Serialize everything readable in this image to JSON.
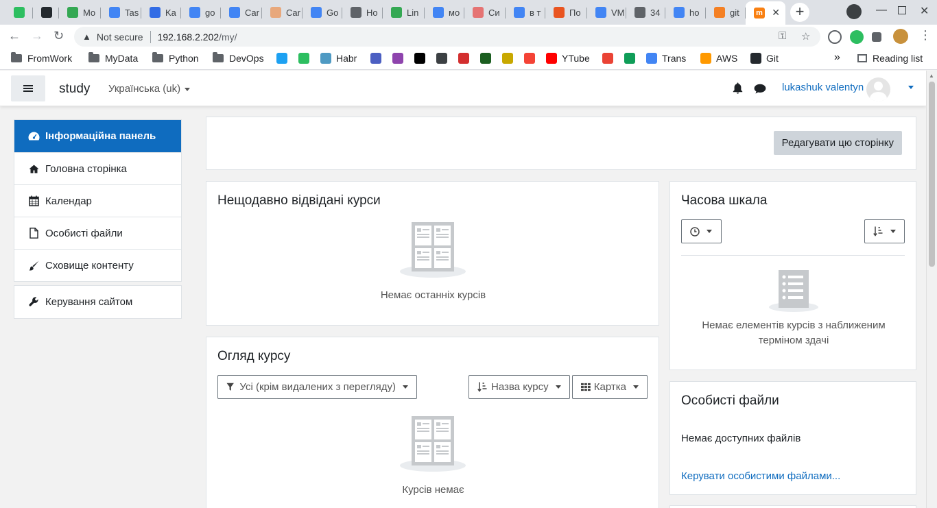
{
  "browser": {
    "tabs": [
      {
        "label": "",
        "color": "#2dbe60"
      },
      {
        "label": "",
        "color": "#24292e"
      },
      {
        "label": "Mo",
        "color": "#34a853"
      },
      {
        "label": "Tas",
        "color": "#4285f4"
      },
      {
        "label": "Ka",
        "color": "#326ce5"
      },
      {
        "label": "go",
        "color": "#4285f4"
      },
      {
        "label": "Car",
        "color": "#4285f4"
      },
      {
        "label": "Car",
        "color": "#e8a87c"
      },
      {
        "label": "Go",
        "color": "#4285f4"
      },
      {
        "label": "Ho",
        "color": "#5f6368"
      },
      {
        "label": "Lin",
        "color": "#34a853"
      },
      {
        "label": "мо",
        "color": "#4285f4"
      },
      {
        "label": "Си",
        "color": "#e57373"
      },
      {
        "label": "в т",
        "color": "#4285f4"
      },
      {
        "label": "По",
        "color": "#e95420"
      },
      {
        "label": "VM",
        "color": "#4285f4"
      },
      {
        "label": "34",
        "color": "#5f6368"
      },
      {
        "label": "ho",
        "color": "#4285f4"
      },
      {
        "label": "git",
        "color": "#f48024"
      }
    ],
    "active_tab_icon": "moodle-icon",
    "active_tab_close": "✕",
    "new_tab": "+",
    "address": {
      "warning": "Not secure",
      "host": "192.168.2.202",
      "path": "/my/"
    },
    "bookmarks": [
      {
        "label": "FromWork",
        "type": "folder"
      },
      {
        "label": "MyData",
        "type": "folder"
      },
      {
        "label": "Python",
        "type": "folder"
      },
      {
        "label": "DevOps",
        "type": "folder"
      },
      {
        "label": "",
        "type": "icon",
        "color": "#1da1f2"
      },
      {
        "label": "",
        "type": "icon",
        "color": "#2dbe60"
      },
      {
        "label": "Habr",
        "type": "icon",
        "color": "#4f9ac3"
      },
      {
        "label": "",
        "type": "icon",
        "color": "#4c5fc2"
      },
      {
        "label": "",
        "type": "icon",
        "color": "#8e44ad"
      },
      {
        "label": "",
        "type": "icon",
        "color": "#000000"
      },
      {
        "label": "",
        "type": "icon",
        "color": "#3c4043"
      },
      {
        "label": "",
        "type": "icon",
        "color": "#d32f2f"
      },
      {
        "label": "",
        "type": "icon",
        "color": "#1b5e20"
      },
      {
        "label": "",
        "type": "icon",
        "color": "#c8a800"
      },
      {
        "label": "",
        "type": "icon",
        "color": "#f44336"
      },
      {
        "label": "YTube",
        "type": "icon",
        "color": "#ff0000"
      },
      {
        "label": "",
        "type": "icon",
        "color": "#ea4335"
      },
      {
        "label": "",
        "type": "icon",
        "color": "#0f9d58"
      },
      {
        "label": "Trans",
        "type": "icon",
        "color": "#4285f4"
      },
      {
        "label": "AWS",
        "type": "icon",
        "color": "#ff9900"
      },
      {
        "label": "Git",
        "type": "icon",
        "color": "#24292e"
      }
    ],
    "overflow": "»",
    "reading_list": "Reading list"
  },
  "navbar": {
    "site_name": "study",
    "language": "Українська (uk)",
    "user_name": "lukashuk valentyn"
  },
  "sidenav": {
    "items": [
      {
        "label": "Інформаційна панель",
        "icon": "dashboard-icon",
        "active": true
      },
      {
        "label": "Головна сторінка",
        "icon": "home-icon"
      },
      {
        "label": "Календар",
        "icon": "calendar-icon"
      },
      {
        "label": "Особисті файли",
        "icon": "file-icon"
      },
      {
        "label": "Сховище контенту",
        "icon": "brush-icon"
      }
    ],
    "admin": {
      "label": "Керування сайтом",
      "icon": "wrench-icon"
    }
  },
  "main": {
    "edit_button": "Редагувати цю сторінку",
    "recent": {
      "title": "Нещодавно відвідані курси",
      "empty": "Немає останніх курсів"
    },
    "overview": {
      "title": "Огляд курсу",
      "filter": "Усі (крім видалених з перегляду)",
      "sort": "Назва курсу",
      "view": "Картка",
      "empty": "Курсів немає"
    },
    "timeline": {
      "title": "Часова шкала",
      "empty_line1": "Немає елементів курсів з наближеним",
      "empty_line2": "терміном здачі"
    },
    "files": {
      "title": "Особисті файли",
      "empty": "Немає доступних файлів",
      "manage_link": "Керувати особистими файлами..."
    }
  },
  "colors": {
    "primary": "#0f6cbf",
    "page_bg": "#f2f2f2"
  }
}
